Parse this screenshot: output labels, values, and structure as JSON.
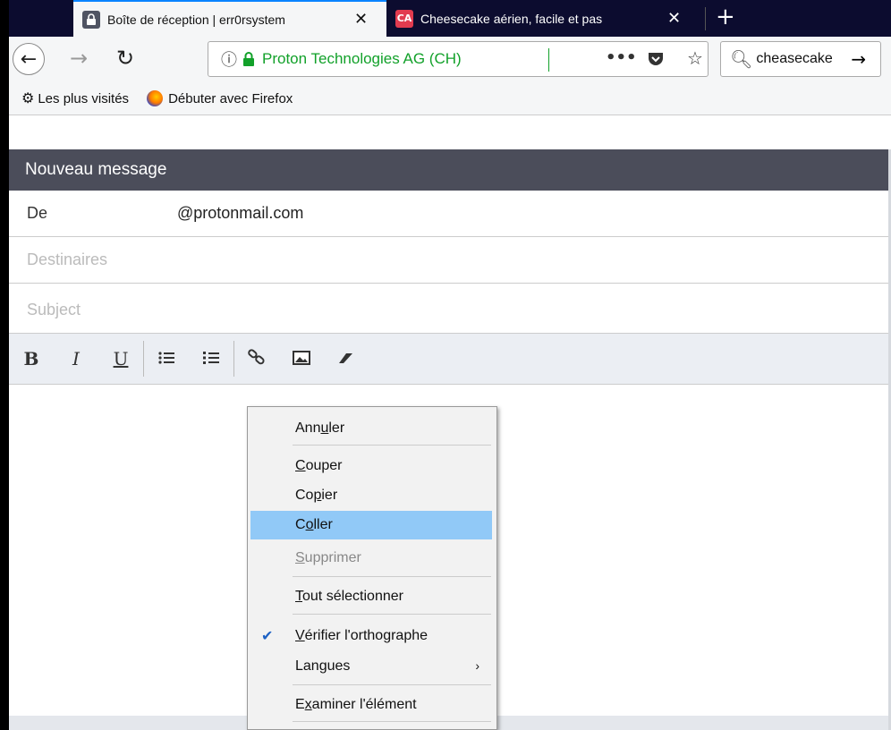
{
  "browser": {
    "tabs": [
      {
        "title": "Boîte de réception | err0rsystem",
        "favicon": "proton-lock-icon",
        "active": true
      },
      {
        "title": "Cheesecake aérien, facile et pas",
        "favicon": "CA",
        "active": false
      }
    ],
    "url_identity": "Proton Technologies AG (CH)",
    "search_value": "cheasecake",
    "bookmarks": [
      {
        "label": "Les plus visités",
        "icon": "gear-icon"
      },
      {
        "label": "Débuter avec Firefox",
        "icon": "firefox-icon"
      }
    ]
  },
  "compose": {
    "header": "Nouveau message",
    "from_label": "De",
    "from_value": "@protonmail.com",
    "to_placeholder": "Destinaires",
    "subject_placeholder": "Subject",
    "toolbar": {
      "bold": "B",
      "italic": "I",
      "underline": "U"
    }
  },
  "context_menu": {
    "items": [
      {
        "pre": "Ann",
        "ul": "u",
        "post": "ler"
      },
      {
        "pre": "",
        "ul": "C",
        "post": "ouper"
      },
      {
        "pre": "Co",
        "ul": "p",
        "post": "ier"
      },
      {
        "pre": "C",
        "ul": "o",
        "post": "ller"
      },
      {
        "pre": "",
        "ul": "S",
        "post": "upprimer"
      },
      {
        "pre": "",
        "ul": "T",
        "post": "out sélectionner"
      },
      {
        "pre": "",
        "ul": "V",
        "post": "érifier l'orthographe"
      },
      {
        "pre": "Lan",
        "ul": "g",
        "post": "ues"
      },
      {
        "pre": "E",
        "ul": "x",
        "post": "aminer l'élément"
      }
    ]
  },
  "colors": {
    "accent": "#0a84ff",
    "secure_green": "#12a12a",
    "menu_highlight": "#91c9f7",
    "compose_header": "#4b4d5a"
  }
}
